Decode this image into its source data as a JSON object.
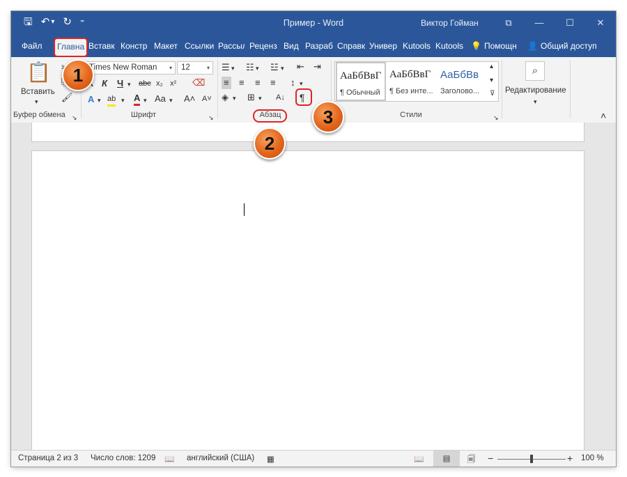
{
  "window": {
    "title": "Пример  -  Word",
    "user": "Виктор Гойман"
  },
  "qat": {
    "save_icon": "🖫",
    "undo_icon": "↶",
    "undo_dropdown": "▾",
    "redo_icon": "↻",
    "customize_icon": "⁼"
  },
  "window_buttons": {
    "ribbon_options": "⧉",
    "minimize": "—",
    "maximize": "☐",
    "close": "✕"
  },
  "tabs": [
    "Файл",
    "Главна",
    "Вставк",
    "Констр",
    "Макет",
    "Ссылки",
    "Рассыл",
    "Реценз",
    "Вид",
    "Разраб",
    "Справк",
    "Универ",
    "Kutools",
    "Kutools"
  ],
  "tell_me": {
    "icon": "💡",
    "label": "Помощн"
  },
  "share": {
    "icon": "👤",
    "label": "Общий доступ"
  },
  "clipboard": {
    "group_label": "Буфер обмена",
    "paste_label": "Вставить",
    "paste_icon": "📋",
    "cut_icon": "✂",
    "copy_icon": "⎘",
    "format_painter_icon": "🖌"
  },
  "font": {
    "group_label": "Шрифт",
    "family": "Times New Roman",
    "size": "12",
    "bold": "Ж",
    "italic": "К",
    "underline": "Ч",
    "strike": "abc",
    "subscript": "x₂",
    "superscript": "x²",
    "grow": "A˄",
    "shrink": "A˅",
    "change_case": "Aa",
    "clear_format_icon": "⌫",
    "text_effects_icon": "A",
    "highlight_icon": "ab",
    "font_color_icon": "A",
    "dropdown": "▾"
  },
  "paragraph": {
    "group_label": "Абзац",
    "bullets_icon": "☰",
    "numbering_icon": "☷",
    "multilevel_icon": "☳",
    "decrease_indent_icon": "⇤",
    "increase_indent_icon": "⇥",
    "align_left_icon": "≡",
    "align_center_icon": "≡",
    "align_right_icon": "≡",
    "justify_icon": "≡",
    "line_spacing_icon": "↕",
    "shading_icon": "◈",
    "borders_icon": "⊞",
    "sort_icon": "A↓",
    "show_marks": "¶"
  },
  "styles": {
    "group_label": "Стили",
    "items": [
      {
        "sample": "АаБбВвГ",
        "name": "¶ Обычный"
      },
      {
        "sample": "АаБбВвГ",
        "name": "¶ Без инте..."
      },
      {
        "sample": "АаБбВв",
        "name": "Заголово..."
      }
    ],
    "scroll_up": "▴",
    "scroll_down": "▾",
    "more": "⊽"
  },
  "editing": {
    "label": "Редактирование",
    "icon": "⌕",
    "dropdown": "▾"
  },
  "collapse_ribbon": "˄",
  "launcher_icon": "↘",
  "badges": {
    "one": "1",
    "two": "2",
    "three": "3"
  },
  "status": {
    "page": "Страница 2 из 3",
    "words": "Число слов: 1209",
    "proofing_icon": "📖",
    "language": "английский (США)",
    "macro_icon": "▦",
    "read_mode_icon": "📖",
    "print_layout_icon": "▤",
    "web_layout_icon": "🗐",
    "zoom_out": "−",
    "zoom_in": "+",
    "zoom": "100 %",
    "zoom_percent": 50
  },
  "colors": {
    "brand": "#2b579a",
    "highlight": "#e02424",
    "badge": "#e4661d"
  }
}
